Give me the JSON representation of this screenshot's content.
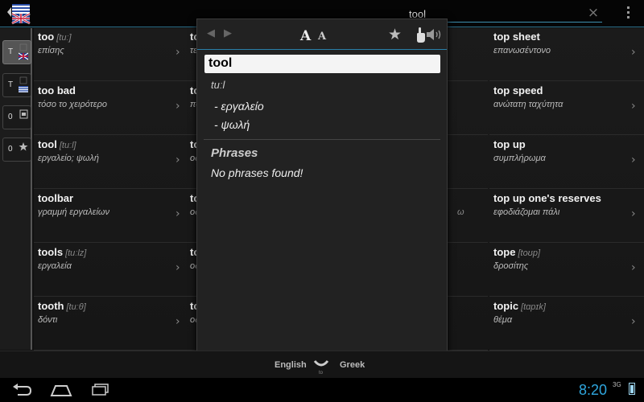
{
  "search": {
    "value": "tool",
    "clear_symbol": "×"
  },
  "left_tabs": [
    {
      "label": "T",
      "flag": "uk",
      "active": true
    },
    {
      "label": "T",
      "flag": "gr",
      "active": false
    },
    {
      "label": "0",
      "icon": "history-icon",
      "active": false
    },
    {
      "label": "0",
      "icon": "star-icon",
      "active": false
    }
  ],
  "list": {
    "chevron": "›",
    "col1": [
      {
        "word": "too",
        "pron": "[tuː]",
        "trans": "επίσης"
      },
      {
        "word": "too bad",
        "pron": "",
        "trans": "τόσο το χειρότερο"
      },
      {
        "word": "tool",
        "pron": "[tuːl]",
        "trans": "εργαλείο; ψωλή"
      },
      {
        "word": "toolbar",
        "pron": "",
        "trans": "γραμμή εργαλείων"
      },
      {
        "word": "tools",
        "pron": "[tuːlz]",
        "trans": "εργαλεία"
      },
      {
        "word": "tooth",
        "pron": "[tuːθ]",
        "trans": "δόντι"
      }
    ],
    "col2_partials": [
      {
        "word": "to",
        "trans": "τε"
      },
      {
        "word": "to",
        "trans": "πο"
      },
      {
        "word": "to",
        "trans": "οδ"
      },
      {
        "word": "to",
        "trans": "οδ"
      },
      {
        "word": "to",
        "trans": "οδ"
      },
      {
        "word": "to",
        "trans": "οδ"
      }
    ],
    "col3_fragment": "ω",
    "col4": [
      {
        "word": "top sheet",
        "pron": "",
        "trans": "επανωσέντονο"
      },
      {
        "word": "top speed",
        "pron": "",
        "trans": "ανώτατη ταχύτητα"
      },
      {
        "word": "top up",
        "pron": "",
        "trans": "συμπλήρωμα"
      },
      {
        "word": "top up one's reserves",
        "pron": "",
        "trans": "εφοδιάζομαι πάλι"
      },
      {
        "word": "tope",
        "pron": "[toʊp]",
        "trans": "δροσίτης"
      },
      {
        "word": "topic",
        "pron": "[tɑpɪk]",
        "trans": "θέμα"
      }
    ]
  },
  "popup": {
    "toolbar": {
      "back_symbol": "◀",
      "forward_symbol": "▶",
      "font_big": "A",
      "font_small": "A",
      "star_symbol": "★"
    },
    "headword": "tool",
    "pronunciation": "tuːl",
    "meanings": [
      "- εργαλείο",
      "- ψωλή"
    ],
    "phrases_title": "Phrases",
    "phrases_empty": "No phrases found!"
  },
  "langbar": {
    "from": "English",
    "to": "Greek",
    "to_label": "to"
  },
  "status": {
    "time": "8:20",
    "signal": "3G"
  },
  "colors": {
    "accent": "#2fa6de",
    "divider": "#2a7fa8"
  }
}
